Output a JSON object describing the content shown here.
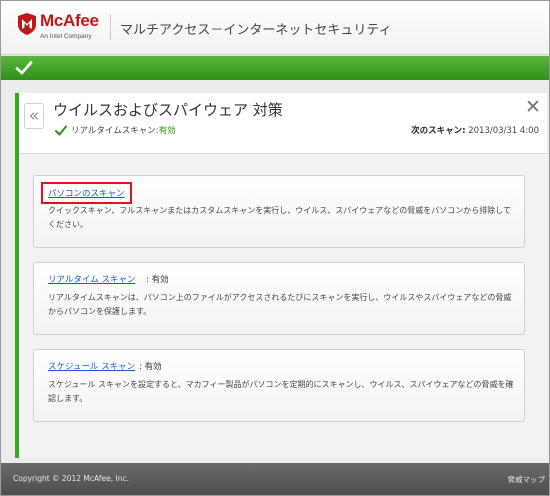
{
  "header": {
    "brand_name": "McAfee",
    "brand_sub": "An Intel Company",
    "product_title": "マルチアクセス－インターネットセキュリティ"
  },
  "panel": {
    "title": "ウイルスおよびスパイウェア 対策",
    "realtime_label": "リアルタイムスキャン:",
    "realtime_value": "有効",
    "next_scan_label": "次のスキャン:",
    "next_scan_value": "2013/03/31 4:00",
    "close_symbol": "✕",
    "back_symbol": "«"
  },
  "cards": [
    {
      "link": "パソコンのスキャン",
      "status": "",
      "description": "クイックスキャン、フルスキャンまたはカスタムスキャンを実行し、ウイルス、スパイウェアなどの脅威をパソコンから排除してください。"
    },
    {
      "link": "リアルタイム スキャン",
      "status": ": 有効",
      "description": "リアルタイムスキャンは、パソコン上のファイルがアクセスされるたびにスキャンを実行し、ウイルスやスパイウェアなどの脅威からパソコンを保護します。"
    },
    {
      "link": "スケジュール スキャン",
      "status": ": 有効",
      "description": "スケジュール スキャンを設定すると、マカフィー製品がパソコンを定期的にスキャンし、ウイルス、スパイウェアなどの脅威を確認します。"
    }
  ],
  "footer": {
    "copyright": "Copyright © 2012 McAfee, Inc.",
    "threat_map": "脅威マップ"
  },
  "colors": {
    "brand_red": "#c01818",
    "status_green": "#3a9c24",
    "link_blue": "#1560c4",
    "highlight_red": "#e0141a"
  }
}
